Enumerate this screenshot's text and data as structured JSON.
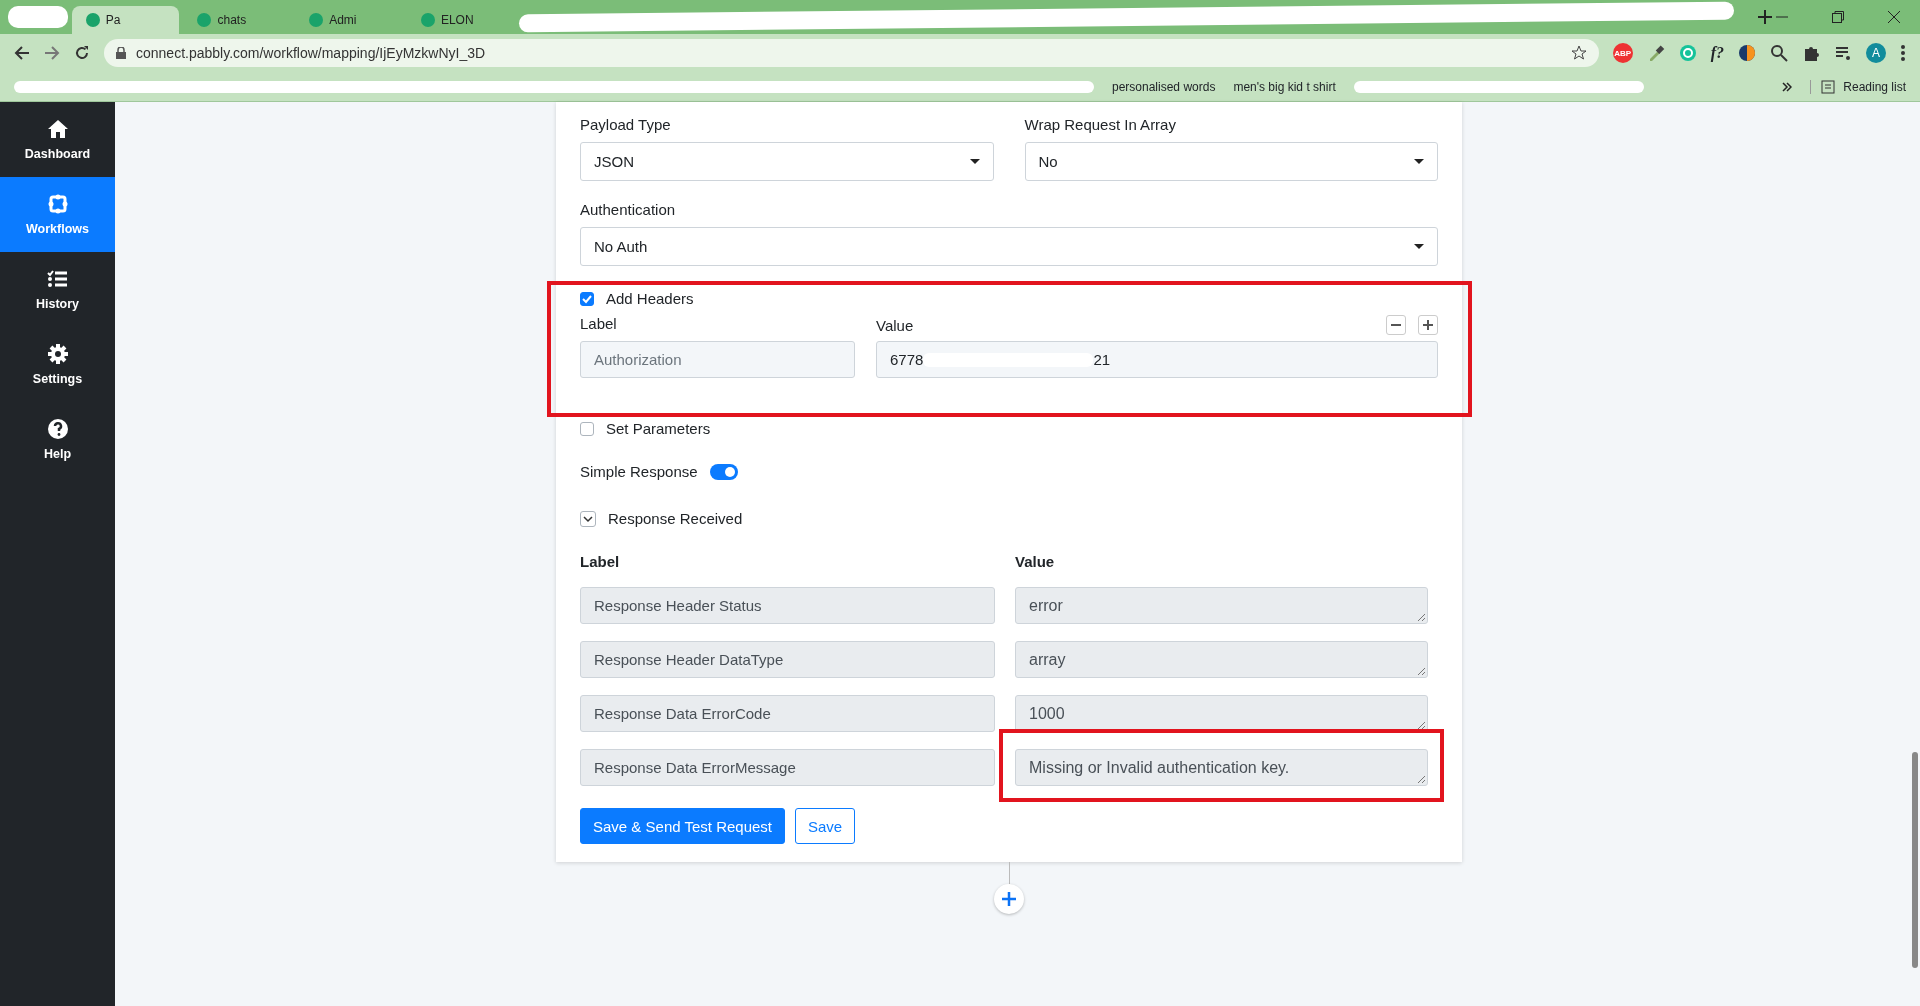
{
  "browser": {
    "tabs": [
      {
        "title": "Pa",
        "selected": true
      },
      {
        "title": "chats",
        "selected": false
      },
      {
        "title": "Admi",
        "selected": false
      },
      {
        "title": "ELON",
        "selected": false
      }
    ],
    "url": "connect.pabbly.com/workflow/mapping/IjEyMzkwNyI_3D",
    "extensions": [
      "ABP",
      "f?"
    ],
    "profile": "A",
    "bookmarks": [
      "personalised words",
      "men's big kid t shirt"
    ],
    "reading_list": "Reading list"
  },
  "sidebar": {
    "items": [
      {
        "label": "Dashboard",
        "selected": false
      },
      {
        "label": "Workflows",
        "selected": true
      },
      {
        "label": "History",
        "selected": false
      },
      {
        "label": "Settings",
        "selected": false
      },
      {
        "label": "Help",
        "selected": false
      }
    ]
  },
  "form": {
    "payload_type": {
      "label": "Payload Type",
      "value": "JSON"
    },
    "wrap_request": {
      "label": "Wrap Request In Array",
      "value": "No"
    },
    "authentication": {
      "label": "Authentication",
      "value": "No Auth"
    },
    "add_headers": {
      "label": "Add Headers",
      "checked": true,
      "highlighted": true,
      "label_heading": "Label",
      "value_heading": "Value",
      "header": {
        "label": "Authorization",
        "value": "6778",
        "value_tail": "21"
      }
    },
    "set_parameters": {
      "label": "Set Parameters",
      "checked": false
    },
    "simple_response": {
      "label": "Simple Response",
      "on": true
    },
    "response_received": {
      "label": "Response Received",
      "expanded": true,
      "label_heading": "Label",
      "value_heading": "Value",
      "rows": [
        {
          "label": "Response Header Status",
          "value": "error",
          "highlighted": false
        },
        {
          "label": "Response Header DataType",
          "value": "array",
          "highlighted": false
        },
        {
          "label": "Response Data ErrorCode",
          "value": "1000",
          "highlighted": false
        },
        {
          "label": "Response Data ErrorMessage",
          "value": "Missing or Invalid authentication key.",
          "highlighted": true
        }
      ]
    },
    "buttons": [
      {
        "label": "Save & Send Test Request",
        "kind": "primary"
      },
      {
        "label": "Save",
        "kind": "outline"
      }
    ]
  }
}
